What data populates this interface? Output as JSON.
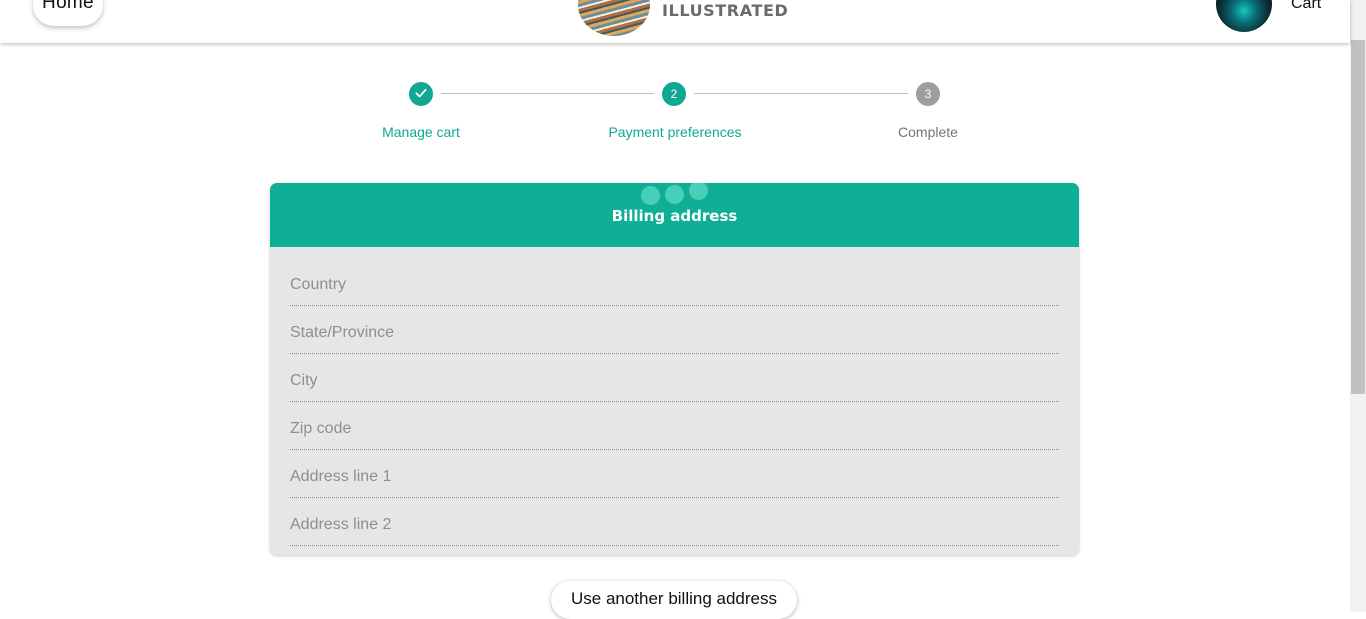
{
  "header": {
    "home_label": "Home",
    "logo_text": "ILLUSTRATED",
    "cart_label": "Cart"
  },
  "stepper": {
    "steps": [
      {
        "number": "1",
        "label": "Manage cart",
        "state": "completed"
      },
      {
        "number": "2",
        "label": "Payment preferences",
        "state": "active"
      },
      {
        "number": "3",
        "label": "Complete",
        "state": "pending"
      }
    ]
  },
  "billing": {
    "title": "Billing address",
    "fields": [
      {
        "placeholder": "Country",
        "value": ""
      },
      {
        "placeholder": "State/Province",
        "value": ""
      },
      {
        "placeholder": "City",
        "value": ""
      },
      {
        "placeholder": "Zip code",
        "value": ""
      },
      {
        "placeholder": "Address line 1",
        "value": ""
      },
      {
        "placeholder": "Address line 2",
        "value": ""
      }
    ],
    "alt_button_label": "Use another billing address"
  },
  "colors": {
    "accent": "#0fae97",
    "step_active": "#10a892",
    "step_pending": "#9e9e9e",
    "card_background": "#e6e6e6",
    "loader": "#48cfb7"
  },
  "icons": {
    "completed_step": "check-icon"
  }
}
